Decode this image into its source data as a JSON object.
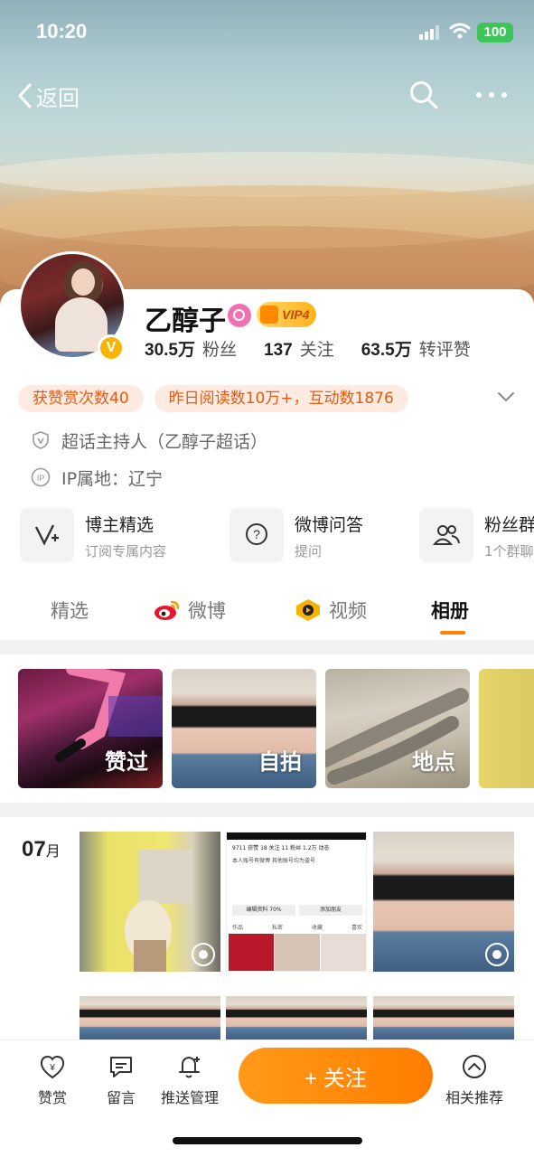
{
  "status_bar": {
    "time": "10:20",
    "battery": "100"
  },
  "nav": {
    "back_label": "返回"
  },
  "profile": {
    "name": "乙醇子",
    "vip_label": "VIP4",
    "stats": [
      {
        "num": "30.5万",
        "label": "粉丝"
      },
      {
        "num": "137",
        "label": "关注"
      },
      {
        "num": "63.5万",
        "label": "转评赞"
      }
    ],
    "tags": [
      "获赞赏次数40",
      "昨日阅读数10万+，互动数1876"
    ],
    "super_host": "超话主持人（乙醇子超话）",
    "ip_location": "IP属地：辽宁"
  },
  "services": [
    {
      "title": "博主精选",
      "subtitle": "订阅专属内容",
      "icon": "featured-icon"
    },
    {
      "title": "微博问答",
      "subtitle": "提问",
      "icon": "question-icon"
    },
    {
      "title": "粉丝群",
      "subtitle": "1个群聊",
      "icon": "group-icon"
    }
  ],
  "tabs": [
    {
      "label": "精选"
    },
    {
      "label": "微博",
      "icon": "weibo-icon"
    },
    {
      "label": "视频",
      "icon": "video-icon"
    },
    {
      "label": "相册",
      "active": true
    }
  ],
  "albums": [
    {
      "label": "赞过"
    },
    {
      "label": "自拍"
    },
    {
      "label": "地点"
    },
    {
      "label": ""
    }
  ],
  "photos": {
    "month_num": "07",
    "month_unit": "月",
    "screenshot": {
      "stats": "9711 获赞  18 关注  11 粉丝  1.2万 动态",
      "bio": "本人账号有微博 其他账号均为盗号",
      "edit": "编辑资料 70%",
      "add": "添加朋友",
      "tabs": [
        "作品",
        "私密",
        "收藏",
        "喜欢"
      ]
    }
  },
  "bottom_bar": {
    "reward": "赞赏",
    "message": "留言",
    "push": "推送管理",
    "follow": "+ 关注",
    "related": "相关推荐"
  },
  "colors": {
    "accent": "#ff8200",
    "tag_bg": "#fdebe1",
    "tag_text": "#e8590c",
    "vip_gold": "#ffb21a"
  }
}
